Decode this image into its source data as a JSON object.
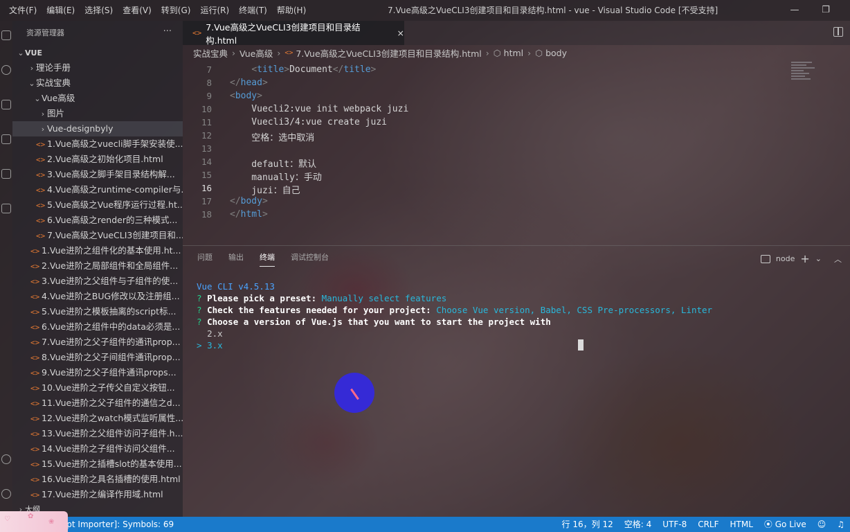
{
  "menu": [
    "文件(F)",
    "编辑(E)",
    "选择(S)",
    "查看(V)",
    "转到(G)",
    "运行(R)",
    "终端(T)",
    "帮助(H)"
  ],
  "window_title": "7.Vue高级之VueCLI3创建项目和目录结构.html - vue - Visual Studio Code [不受支持]",
  "sidebar": {
    "title": "资源管理器",
    "more": "···",
    "root": "VUE",
    "items": [
      {
        "label": "理论手册",
        "type": "folder",
        "open": false
      },
      {
        "label": "实战宝典",
        "type": "folder",
        "open": true
      },
      {
        "label": "Vue高级",
        "type": "folder",
        "open": true
      },
      {
        "label": "图片",
        "type": "folder",
        "open": false
      },
      {
        "label": "Vue-designbyly",
        "type": "folder",
        "open": false
      },
      {
        "label": "1.Vue高级之vuecli脚手架安装使...",
        "type": "file"
      },
      {
        "label": "2.Vue高级之初始化项目.html",
        "type": "file"
      },
      {
        "label": "3.Vue高级之脚手架目录结构解...",
        "type": "file"
      },
      {
        "label": "4.Vue高级之runtime-compiler与...",
        "type": "file"
      },
      {
        "label": "5.Vue高级之Vue程序运行过程.ht...",
        "type": "file"
      },
      {
        "label": "6.Vue高级之render的三种模式...",
        "type": "file"
      },
      {
        "label": "7.Vue高级之VueCLI3创建项目和...",
        "type": "file"
      },
      {
        "label": "1.Vue进阶之组件化的基本使用.ht...",
        "type": "file"
      },
      {
        "label": "2.Vue进阶之局部组件和全局组件...",
        "type": "file"
      },
      {
        "label": "3.Vue进阶之父组件与子组件的使...",
        "type": "file"
      },
      {
        "label": "4.Vue进阶之BUG修改以及注册组...",
        "type": "file"
      },
      {
        "label": "5.Vue进阶之模板抽离的script标...",
        "type": "file"
      },
      {
        "label": "6.Vue进阶之组件中的data必须是...",
        "type": "file"
      },
      {
        "label": "7.Vue进阶之父子组件的通讯prop...",
        "type": "file"
      },
      {
        "label": "8.Vue进阶之父子间组件通讯prop...",
        "type": "file"
      },
      {
        "label": "9.Vue进阶之父子组件通讯props...",
        "type": "file"
      },
      {
        "label": "10.Vue进阶之子传父自定义按钮...",
        "type": "file"
      },
      {
        "label": "11.Vue进阶之父子组件的通信之d...",
        "type": "file"
      },
      {
        "label": "12.Vue进阶之watch模式监听属性...",
        "type": "file"
      },
      {
        "label": "13.Vue进阶之父组件访问子组件.h...",
        "type": "file"
      },
      {
        "label": "14.Vue进阶之子组件访问父组件...",
        "type": "file"
      },
      {
        "label": "15.Vue进阶之插槽slot的基本使用...",
        "type": "file"
      },
      {
        "label": "16.Vue进阶之具名插槽的使用.html",
        "type": "file"
      },
      {
        "label": "17.Vue进阶之编译作用域.html",
        "type": "file"
      }
    ],
    "outline": "大纲"
  },
  "tab": {
    "icon": "<>",
    "label": "7.Vue高级之VueCLI3创建项目和目录结构.html",
    "close": "×"
  },
  "breadcrumb": [
    "实战宝典",
    "Vue高级",
    "7.Vue高级之VueCLI3创建项目和目录结构.html",
    "html",
    "body"
  ],
  "editor": {
    "lines": [
      {
        "n": "7",
        "text": "    <title>Document</title>"
      },
      {
        "n": "8",
        "text": "</head>"
      },
      {
        "n": "9",
        "text": "<body>"
      },
      {
        "n": "10",
        "text": "    Vuecli2:vue init webpack juzi"
      },
      {
        "n": "11",
        "text": "    Vuecli3/4:vue create juzi"
      },
      {
        "n": "12",
        "text": "    空格：选中取消"
      },
      {
        "n": "13",
        "text": ""
      },
      {
        "n": "14",
        "text": "    default：默认"
      },
      {
        "n": "15",
        "text": "    manually：手动"
      },
      {
        "n": "16",
        "text": "    juzi：自己"
      },
      {
        "n": "17",
        "text": "</body>"
      },
      {
        "n": "18",
        "text": "</html>"
      }
    ],
    "current_line": "16"
  },
  "panel": {
    "tabs": [
      "问题",
      "输出",
      "终端",
      "调试控制台"
    ],
    "active_tab": "终端",
    "terminal_name": "node",
    "terminal": {
      "header": "Vue CLI v4.5.13",
      "q1_prefix": "?",
      "q1": "Please pick a preset:",
      "q1_answer": "Manually select features",
      "q2_prefix": "?",
      "q2": "Check the features needed for your project:",
      "q2_answer": "Choose Vue version, Babel, CSS Pre-processors, Linter",
      "q3_prefix": "?",
      "q3": "Choose a version of Vue.js that you want to start the project with",
      "opt1": "2.x",
      "opt2_marker": ">",
      "opt2": "3.x"
    }
  },
  "status": {
    "left": "ript Importer]: Symbols: 69",
    "right": [
      "行 16，列 12",
      "空格: 4",
      "UTF-8",
      "CRLF",
      "HTML",
      "Go Live"
    ]
  },
  "colors": {
    "statusbar": "#1a7acb",
    "keyword_tag": "#569cd6",
    "term_green": "#23d18b",
    "term_cyan": "#29b8db"
  }
}
